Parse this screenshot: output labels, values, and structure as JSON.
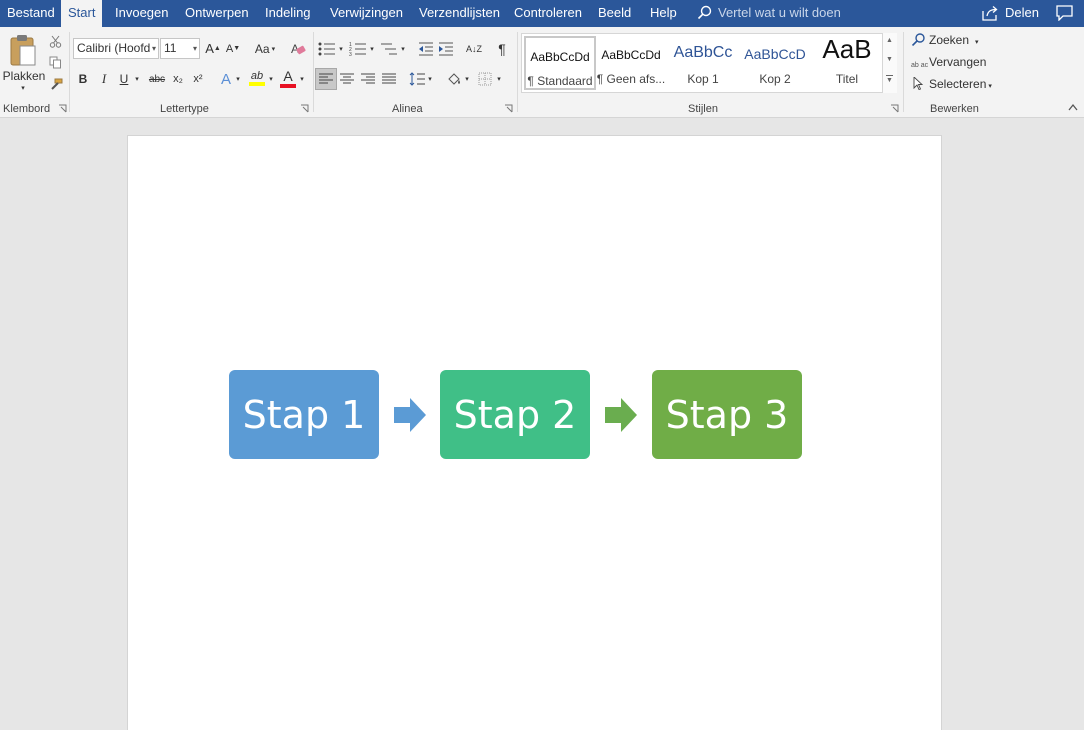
{
  "tabs": [
    {
      "label": "Bestand",
      "active": false
    },
    {
      "label": "Start",
      "active": true
    },
    {
      "label": "Invoegen",
      "active": false
    },
    {
      "label": "Ontwerpen",
      "active": false
    },
    {
      "label": "Indeling",
      "active": false
    },
    {
      "label": "Verwijzingen",
      "active": false
    },
    {
      "label": "Verzendlijsten",
      "active": false
    },
    {
      "label": "Controleren",
      "active": false
    },
    {
      "label": "Beeld",
      "active": false
    },
    {
      "label": "Help",
      "active": false
    }
  ],
  "tell_me": {
    "placeholder": "Vertel wat u wilt doen",
    "icon": "lightbulb-search-icon"
  },
  "share": {
    "label": "Delen",
    "icon": "share-icon"
  },
  "comment_icon": "comment-icon",
  "ribbon": {
    "clipboard": {
      "group_label": "Klembord",
      "paste_label": "Plakken"
    },
    "font": {
      "group_label": "Lettertype",
      "font_name": "Calibri (Hoofd",
      "font_size": "11",
      "change_case": "Aa",
      "bold": "B",
      "italic": "I",
      "underline": "U",
      "strike": "abc",
      "subscript": "x₂",
      "superscript": "x²",
      "text_effect": "A",
      "highlight": "ab",
      "font_color": "A",
      "grow": "A",
      "shrink": "A"
    },
    "paragraph": {
      "group_label": "Alinea",
      "pilcrow": "¶",
      "sort": "A↓Z"
    },
    "styles": {
      "group_label": "Stijlen",
      "items": [
        {
          "sample": "AaBbCcDd",
          "name": "¶ Standaard"
        },
        {
          "sample": "AaBbCcDd",
          "name": "¶ Geen afs..."
        },
        {
          "sample": "AaBbCc",
          "name": "Kop 1"
        },
        {
          "sample": "AaBbCcD",
          "name": "Kop 2"
        },
        {
          "sample": "AaB",
          "name": "Titel"
        }
      ]
    },
    "editing": {
      "group_label": "Bewerken",
      "find": "Zoeken",
      "replace": "Vervangen",
      "select": "Selecteren",
      "replace_icon_text": "ab ac"
    }
  },
  "document": {
    "steps": [
      {
        "label": "Stap 1",
        "color": "#5b9bd5"
      },
      {
        "label": "Stap 2",
        "color": "#40bf87"
      },
      {
        "label": "Stap 3",
        "color": "#70ad47"
      }
    ],
    "arrows": [
      {
        "color": "#5b9bd5"
      },
      {
        "color": "#6aad4f"
      }
    ]
  },
  "colors": {
    "title_bar": "#2b579a",
    "ribbon": "#f3f3f3",
    "highlight_yellow": "#ffff00",
    "font_red": "#e81123"
  }
}
